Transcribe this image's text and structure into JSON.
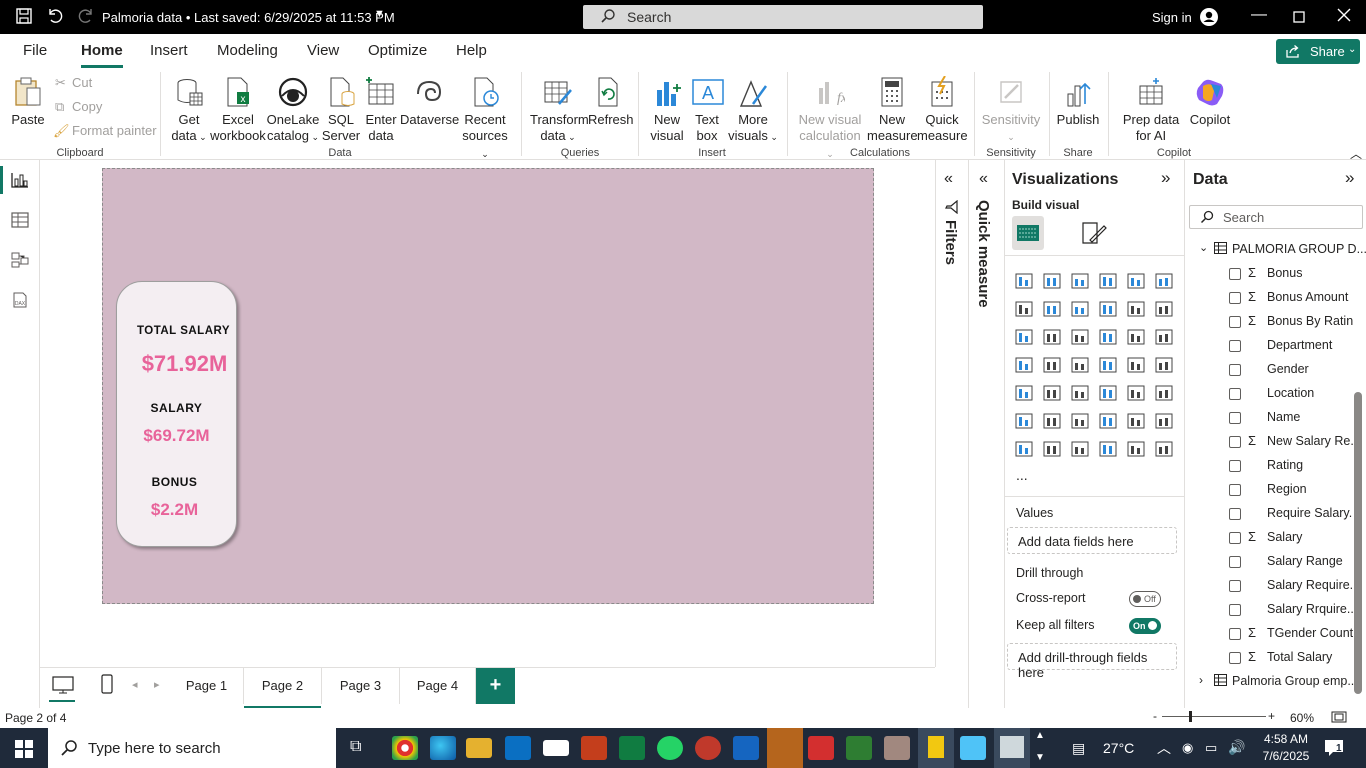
{
  "titlebar": {
    "file_title": "Palmoria data • Last saved: 6/29/2025 at 11:53 PM",
    "search_placeholder": "Search",
    "sign_in": "Sign in"
  },
  "ribbon_tabs": [
    "File",
    "Home",
    "Insert",
    "Modeling",
    "View",
    "Optimize",
    "Help"
  ],
  "share_label": "Share",
  "ribbon": {
    "clipboard": {
      "paste": "Paste",
      "cut": "Cut",
      "copy": "Copy",
      "format_painter": "Format painter",
      "group": "Clipboard"
    },
    "data": {
      "get_data": "Get data",
      "excel": "Excel workbook",
      "onelake": "OneLake catalog",
      "sql": "SQL Server",
      "enter": "Enter data",
      "dataverse": "Dataverse",
      "recent": "Recent sources",
      "group": "Data"
    },
    "queries": {
      "transform": "Transform data",
      "refresh": "Refresh",
      "group": "Queries"
    },
    "insert": {
      "new_visual": "New visual",
      "text_box": "Text box",
      "more_visuals": "More visuals",
      "group": "Insert"
    },
    "calculations": {
      "new_visual_calc": "New visual calculation",
      "new_measure": "New measure",
      "quick_measure": "Quick measure",
      "group": "Calculations"
    },
    "sensitivity": {
      "label": "Sensitivity",
      "group": "Sensitivity"
    },
    "share": {
      "publish": "Publish",
      "group": "Share"
    },
    "copilot": {
      "prep": "Prep data for AI",
      "copilot": "Copilot",
      "group": "Copilot"
    }
  },
  "card": {
    "total_salary_label": "TOTAL SALARY",
    "total_salary_value": "$71.92M",
    "salary_label": "SALARY",
    "salary_value": "$69.72M",
    "bonus_label": "BONUS",
    "bonus_value": "$2.2M"
  },
  "panes": {
    "filters": "Filters",
    "quick_measure": "Quick measure",
    "visualizations": "Visualizations",
    "build_visual": "Build visual",
    "values": "Values",
    "add_data_fields": "Add data fields here",
    "drill_through": "Drill through",
    "cross_report": "Cross-report",
    "cross_report_state": "Off",
    "keep_all_filters": "Keep all filters",
    "keep_all_filters_state": "On",
    "add_drill_through": "Add drill-through fields here",
    "more": "..."
  },
  "data_pane": {
    "title": "Data",
    "search_placeholder": "Search",
    "table": "PALMORIA GROUP D...",
    "fields": [
      {
        "name": "Bonus",
        "sigma": "Σ"
      },
      {
        "name": "Bonus Amount",
        "sigma": "Σ"
      },
      {
        "name": "Bonus By Ratin",
        "sigma": "Σ"
      },
      {
        "name": "Department",
        "sigma": ""
      },
      {
        "name": "Gender",
        "sigma": ""
      },
      {
        "name": "Location",
        "sigma": ""
      },
      {
        "name": "Name",
        "sigma": ""
      },
      {
        "name": "New Salary Re...",
        "sigma": "Σ"
      },
      {
        "name": "Rating",
        "sigma": ""
      },
      {
        "name": "Region",
        "sigma": ""
      },
      {
        "name": "Require Salary...",
        "sigma": ""
      },
      {
        "name": "Salary",
        "sigma": "Σ"
      },
      {
        "name": "Salary Range",
        "sigma": ""
      },
      {
        "name": "Salary Require...",
        "sigma": ""
      },
      {
        "name": "Salary Rrquire...",
        "sigma": ""
      },
      {
        "name": "TGender Count",
        "sigma": "Σ"
      },
      {
        "name": "Total Salary",
        "sigma": "Σ"
      }
    ],
    "table2": "Palmoria Group emp..."
  },
  "pages": [
    "Page 1",
    "Page 2",
    "Page 3",
    "Page 4"
  ],
  "add_page": "+",
  "status": {
    "page": "Page 2 of 4",
    "zoom": "60%"
  },
  "taskbar": {
    "search_placeholder": "Type here to search",
    "weather": "27°C",
    "time": "4:58 AM",
    "date": "7/6/2025",
    "notifications": "1"
  },
  "colors": {
    "accent": "#117865",
    "canvas": "#d2b8c6",
    "card_bg": "#f4eef2",
    "value_pink": "#e8639a"
  }
}
